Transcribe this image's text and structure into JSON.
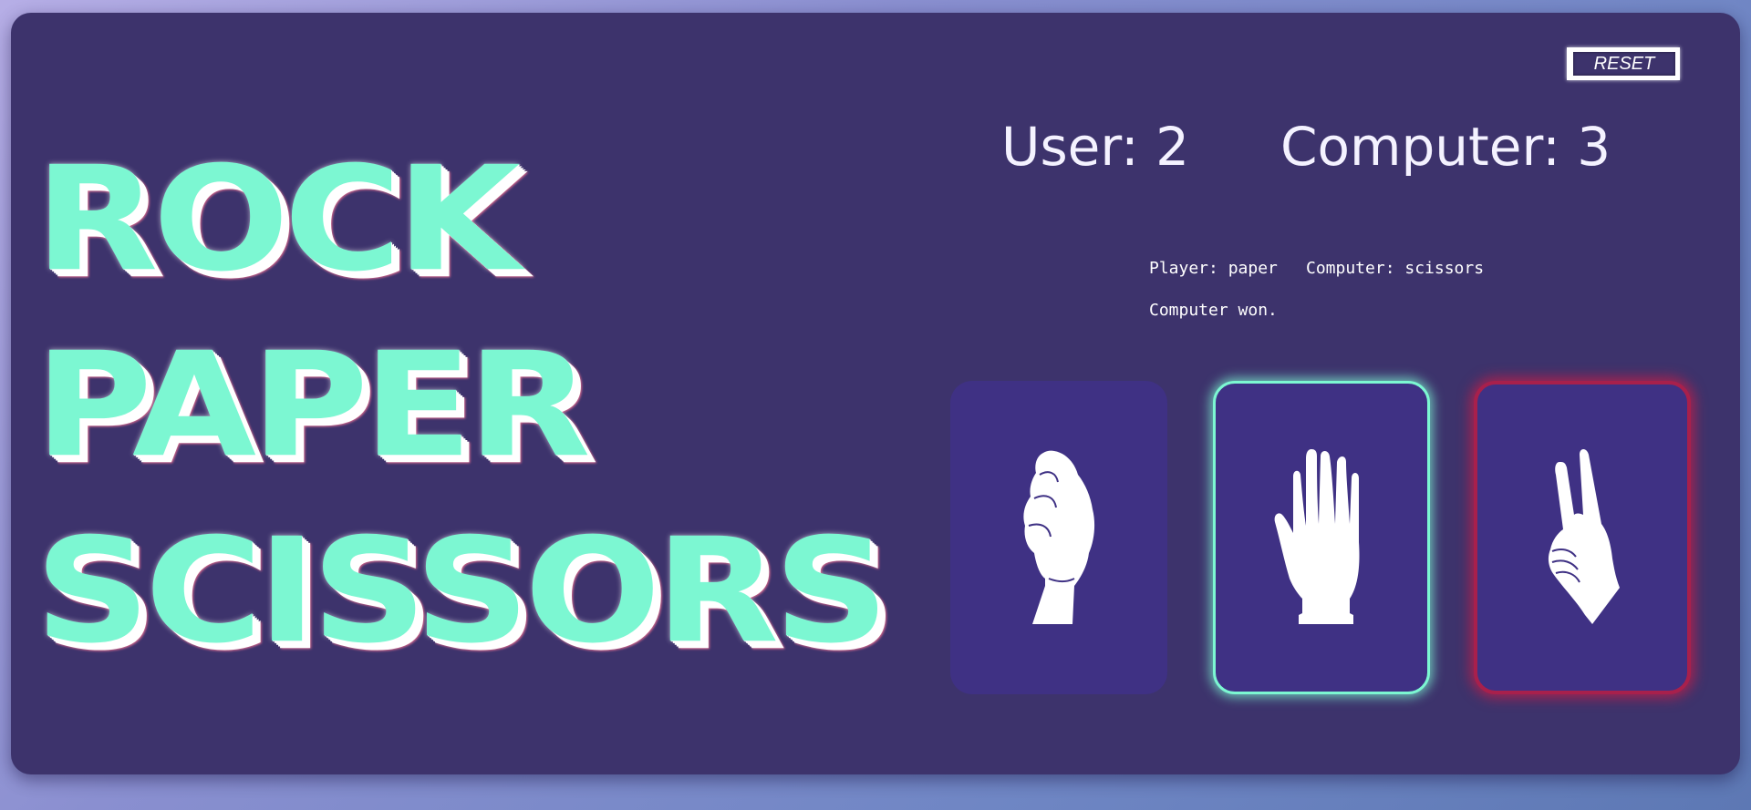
{
  "title": {
    "line1": "ROCK",
    "line2": "PAPER",
    "line3": "SCISSORS"
  },
  "toolbar": {
    "reset_label": "RESET"
  },
  "score": {
    "user": "User: 2",
    "computer": "Computer: 3"
  },
  "round": {
    "player_choice": "Player: paper",
    "computer_choice": "Computer: scissors",
    "result": "Computer won."
  },
  "choices": [
    {
      "name": "rock",
      "icon": "rock-hand-icon",
      "state": "idle"
    },
    {
      "name": "paper",
      "icon": "paper-hand-icon",
      "state": "player-selected"
    },
    {
      "name": "scissors",
      "icon": "scissors-hand-icon",
      "state": "computer-selected"
    }
  ],
  "colors": {
    "accent": "#7cf7d2",
    "panel": "#3d336c",
    "card": "#3f3184",
    "computer_highlight": "#a8204c"
  }
}
